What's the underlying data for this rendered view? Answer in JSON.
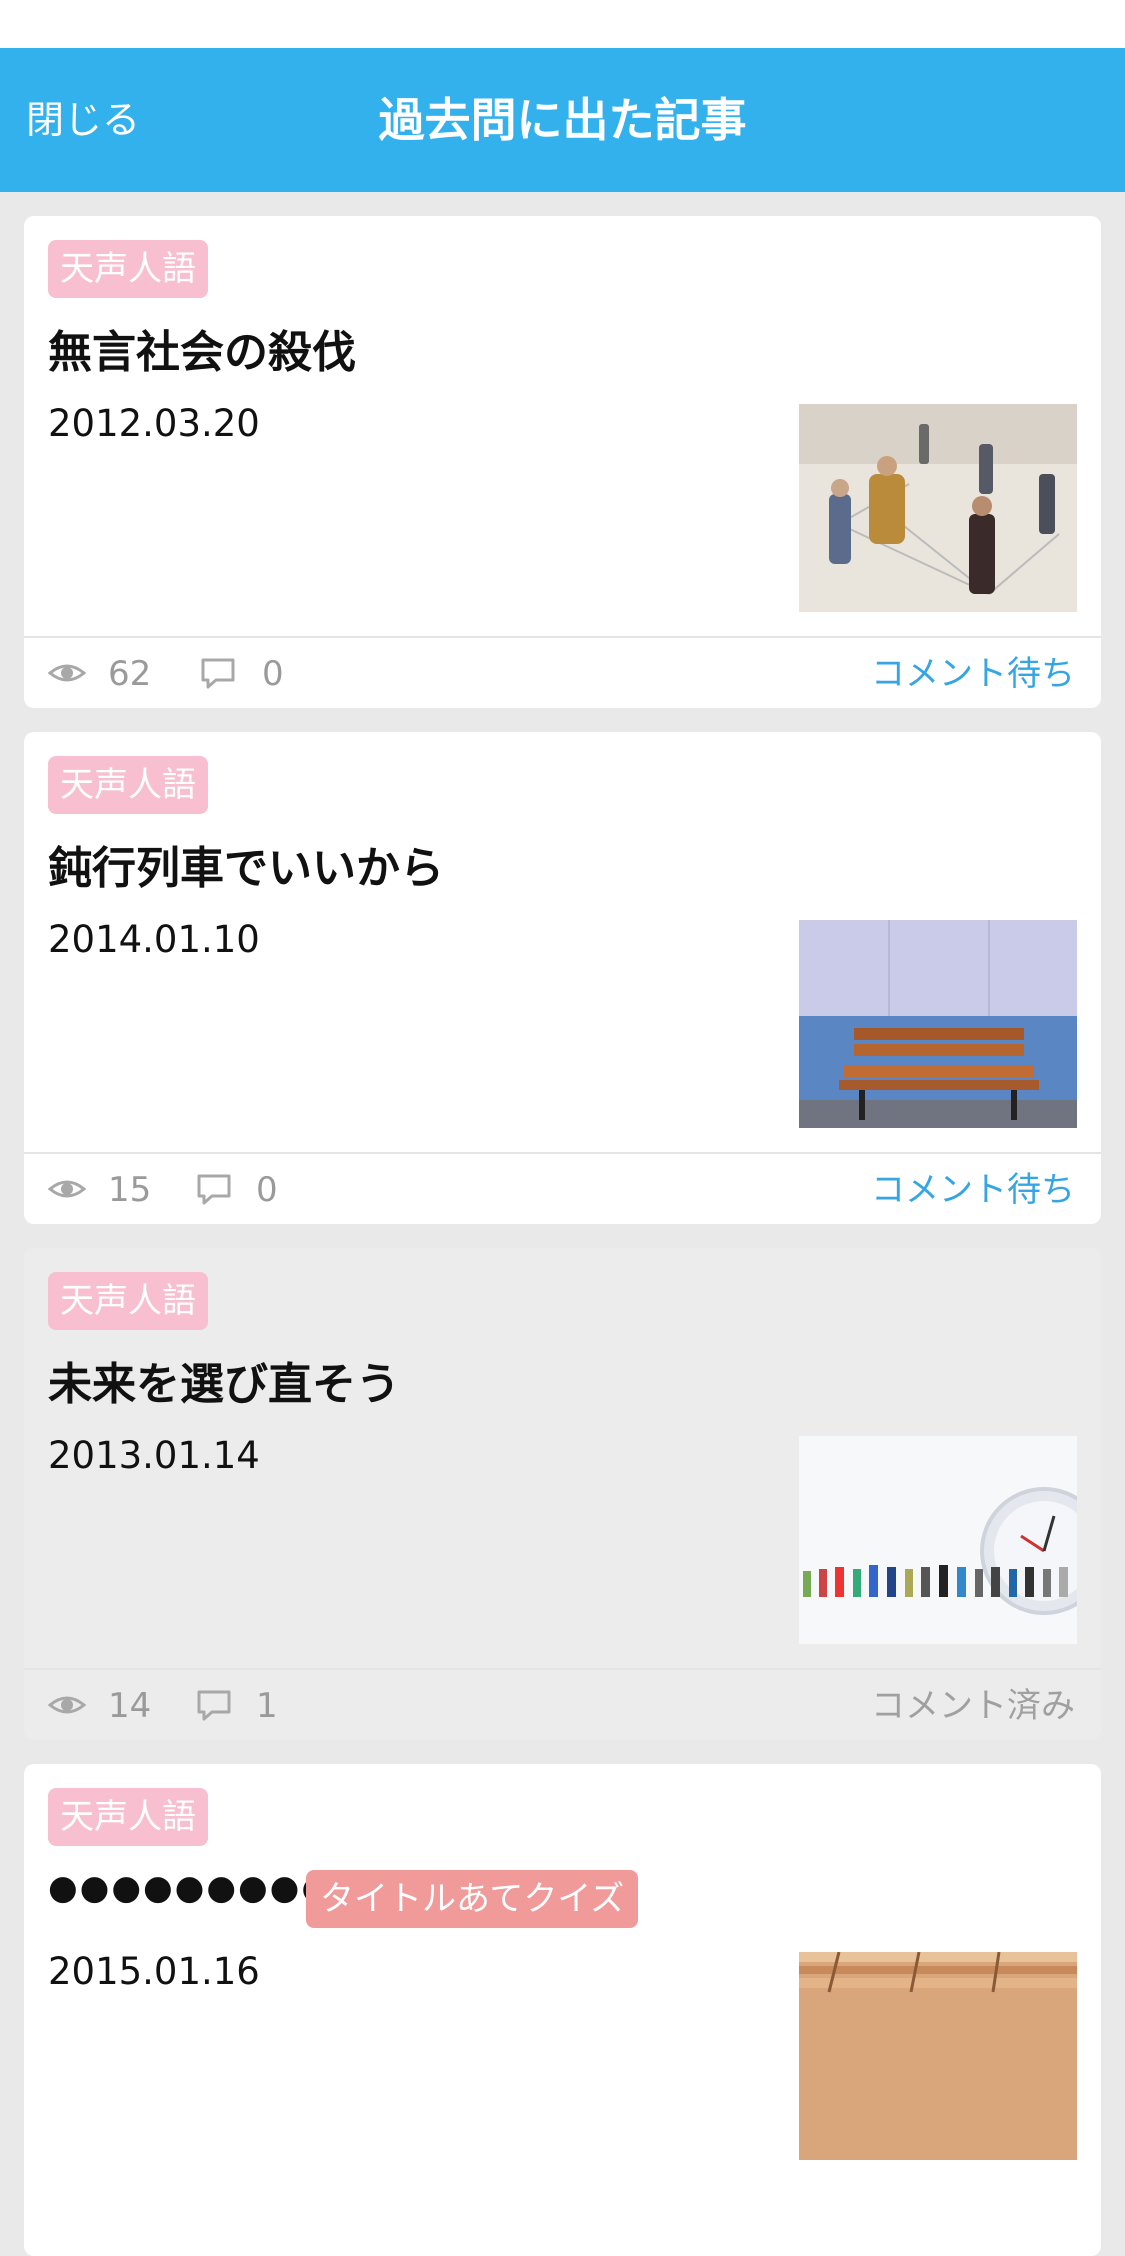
{
  "nav": {
    "close_label": "閉じる",
    "title": "過去問に出た記事"
  },
  "articles": [
    {
      "tag": "天声人語",
      "title": "無言社会の殺伐",
      "date": "2012.03.20",
      "views": "62",
      "comments": "0",
      "status": "コメント待ち",
      "thumbnail": "figurines-network"
    },
    {
      "tag": "天声人語",
      "title": "鈍行列車でいいから",
      "date": "2014.01.10",
      "views": "15",
      "comments": "0",
      "status": "コメント待ち",
      "thumbnail": "wooden-bench"
    },
    {
      "tag": "天声人語",
      "title": "未来を選び直そう",
      "date": "2013.01.14",
      "views": "14",
      "comments": "1",
      "status": "コメント済み",
      "thumbnail": "figurines-clock"
    },
    {
      "tag": "天声人語",
      "title": "●●●●●●●●●●",
      "quiz_tag": "タイトルあてクイズ",
      "date": "2015.01.16",
      "thumbnail": "classroom-desks"
    }
  ],
  "colors": {
    "header": "#33b1ec",
    "tag": "#f8bfd0",
    "quiz_tag": "#f09a9a",
    "link": "#35a6e3"
  }
}
